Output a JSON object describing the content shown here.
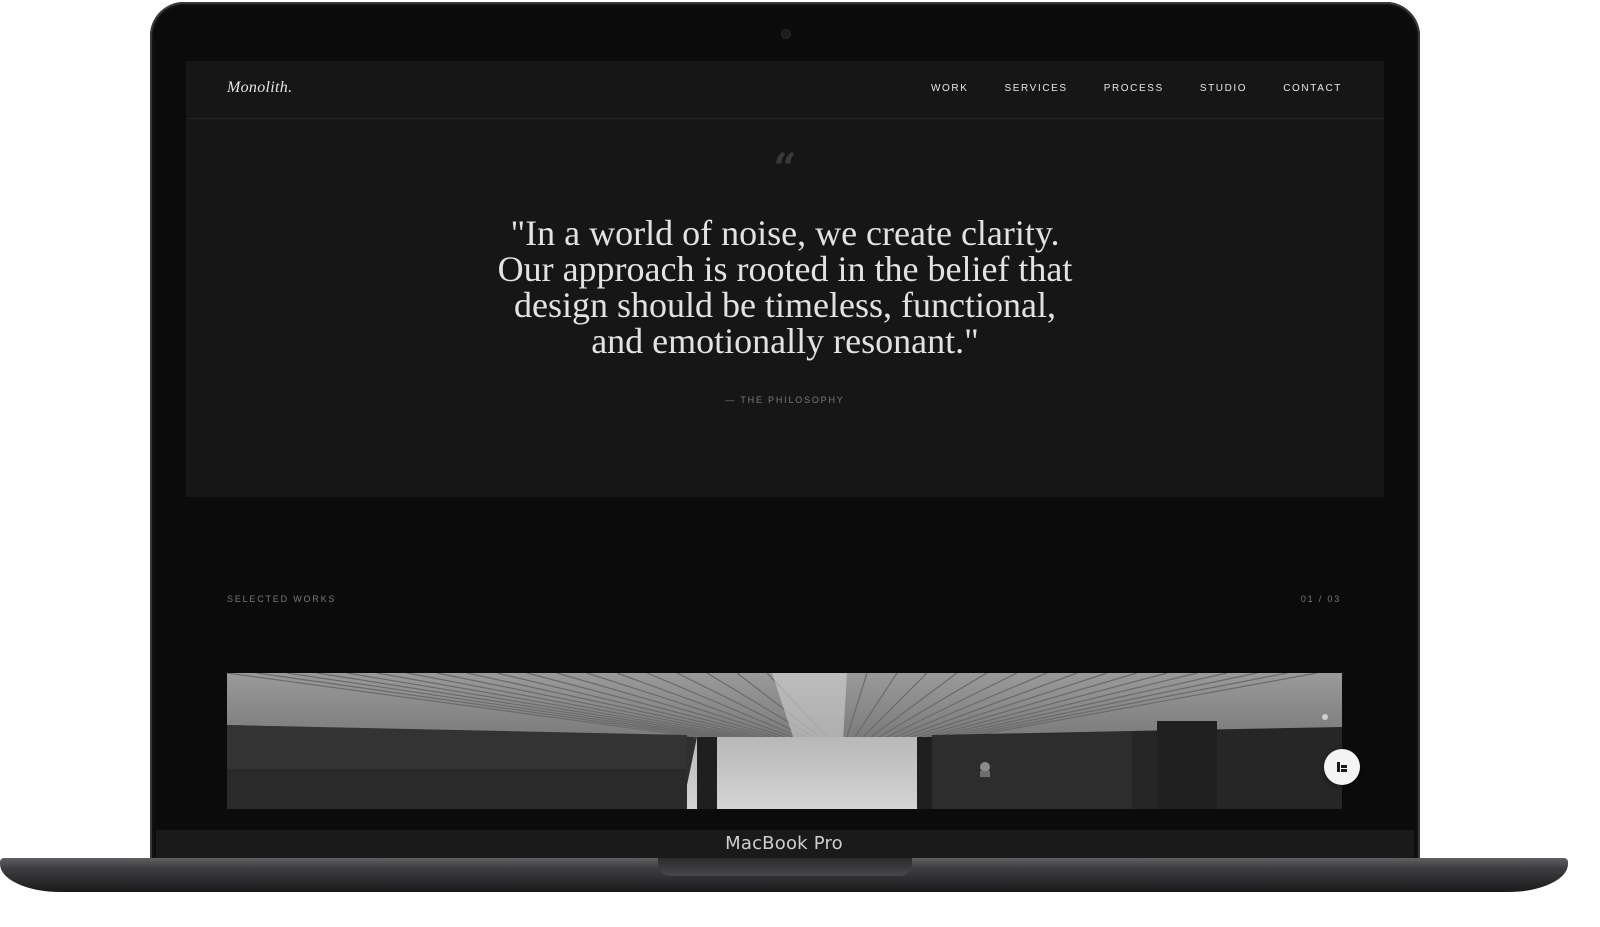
{
  "site": {
    "logo": "Monolith."
  },
  "nav": {
    "items": [
      "WORK",
      "SERVICES",
      "PROCESS",
      "STUDIO",
      "CONTACT"
    ]
  },
  "philosophy": {
    "quote_icon": "quote-mark-icon",
    "quote_lines": [
      "\"In a world of noise, we create clarity.",
      "Our approach is rooted in the belief that",
      "design should be timeless, functional,",
      "and emotionally resonant.\""
    ],
    "attribution": "— THE PHILOSOPHY"
  },
  "works": {
    "label": "SELECTED WORKS",
    "counter": "01 / 03"
  },
  "device": {
    "label": "MacBook Pro"
  },
  "floating_button": {
    "icon": "builder-badge-icon"
  },
  "colors": {
    "page_background": "#161616",
    "works_background": "#0b0b0b",
    "text_primary": "#e2e2e2",
    "text_muted": "#7a7a7a"
  }
}
